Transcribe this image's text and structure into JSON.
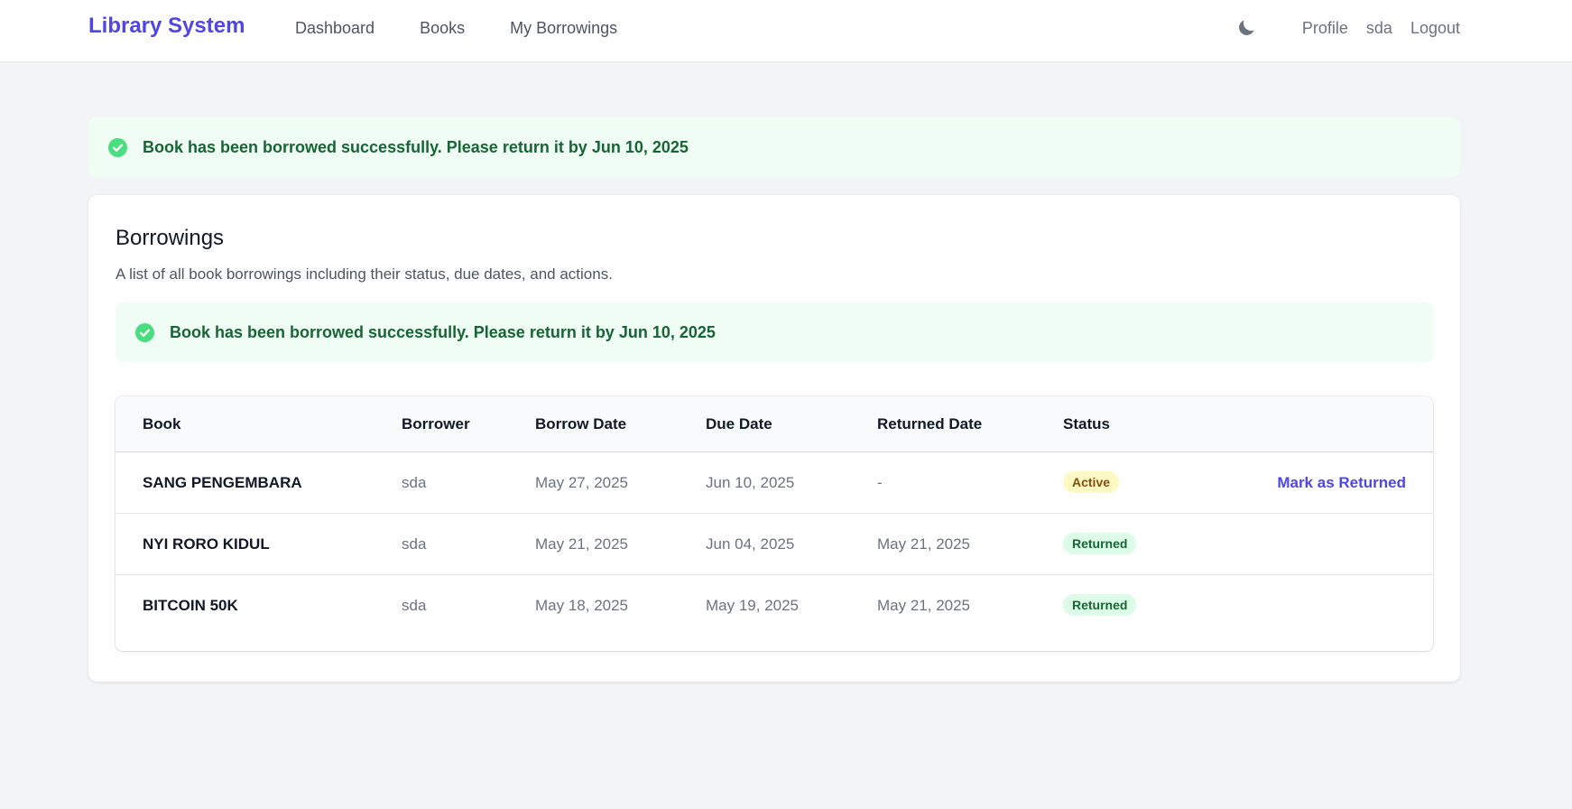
{
  "nav": {
    "brand": "Library System",
    "links": [
      "Dashboard",
      "Books",
      "My Borrowings"
    ],
    "theme_icon": "moon-icon",
    "profile": "Profile",
    "username": "sda",
    "logout": "Logout"
  },
  "alert_top": {
    "icon": "check-circle-icon",
    "text": "Book has been borrowed successfully. Please return it by Jun 10, 2025"
  },
  "card": {
    "title": "Borrowings",
    "subtitle": "A list of all book borrowings including their status, due dates, and actions.",
    "alert": {
      "icon": "check-circle-icon",
      "text": "Book has been borrowed successfully. Please return it by Jun 10, 2025"
    }
  },
  "table": {
    "headers": [
      "Book",
      "Borrower",
      "Borrow Date",
      "Due Date",
      "Returned Date",
      "Status"
    ],
    "rows": [
      {
        "book": "SANG PENGEMBARA",
        "borrower": "sda",
        "borrow_date": "May 27, 2025",
        "due_date": "Jun 10, 2025",
        "returned_date": "-",
        "status": "Active",
        "action": "Mark as Returned"
      },
      {
        "book": "NYI RORO KIDUL",
        "borrower": "sda",
        "borrow_date": "May 21, 2025",
        "due_date": "Jun 04, 2025",
        "returned_date": "May 21, 2025",
        "status": "Returned"
      },
      {
        "book": "BITCOIN 50K",
        "borrower": "sda",
        "borrow_date": "May 18, 2025",
        "due_date": "May 19, 2025",
        "returned_date": "May 21, 2025",
        "status": "Returned"
      }
    ]
  },
  "colors": {
    "accent": "#4f46e5",
    "success_bg": "#f0fdf4",
    "success_text": "#166534",
    "active_badge_bg": "#fef9c3",
    "returned_badge_bg": "#dcfce7"
  }
}
